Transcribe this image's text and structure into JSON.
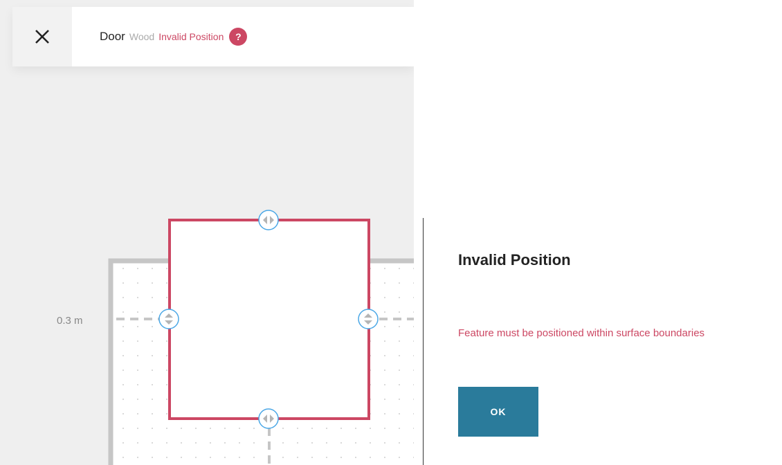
{
  "colors": {
    "accent_red": "#cc4763",
    "button_teal": "#2a7b9b",
    "handle_blue": "#4aa7e6",
    "wall_gray": "#c6c6c6"
  },
  "toolbar": {
    "close_icon": "close-icon",
    "title": "Door",
    "material": "Wood",
    "status": "Invalid Position",
    "help_label": "?"
  },
  "canvas": {
    "dimension_label": "0.3 m",
    "handle_icons": [
      "horizontal-arrows-icon",
      "vertical-arrows-icon"
    ]
  },
  "dialog": {
    "title": "Invalid Position",
    "message": "Feature must be positioned within surface boundaries",
    "ok_label": "OK"
  }
}
